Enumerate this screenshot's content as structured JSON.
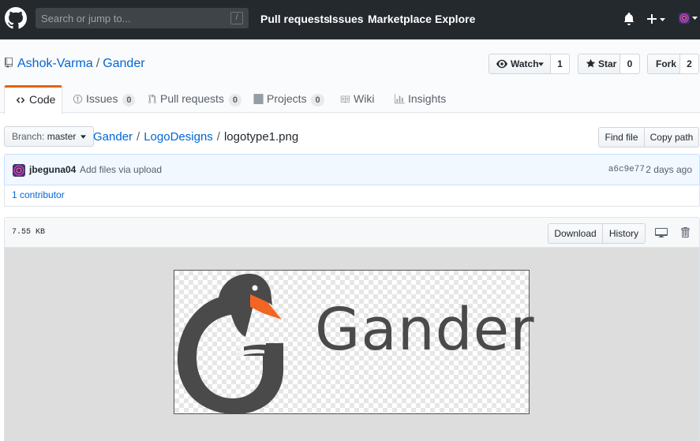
{
  "header": {
    "search_placeholder": "Search or jump to...",
    "search_hotkey": "/",
    "nav": [
      "Pull requests",
      "Issues",
      "Marketplace",
      "Explore"
    ]
  },
  "repo": {
    "owner": "Ashok-Varma",
    "name": "Gander",
    "watch_label": "Watch",
    "watch_count": "1",
    "star_label": "Star",
    "star_count": "0",
    "fork_label": "Fork",
    "fork_count": "2"
  },
  "tabs": [
    {
      "label": "Code"
    },
    {
      "label": "Issues",
      "count": "0"
    },
    {
      "label": "Pull requests",
      "count": "0"
    },
    {
      "label": "Projects",
      "count": "0"
    },
    {
      "label": "Wiki"
    },
    {
      "label": "Insights"
    }
  ],
  "file_nav": {
    "branch_prefix": "Branch:",
    "branch": "master",
    "path": [
      "Gander",
      "LogoDesigns"
    ],
    "filename": "logotype1.png",
    "find_file": "Find file",
    "copy_path": "Copy path"
  },
  "commit": {
    "author": "jbeguna04",
    "message": "Add files via upload",
    "sha": "a6c9e77",
    "time": "2 days ago",
    "contributors": "1 contributor"
  },
  "file": {
    "size": "7.55 KB",
    "download": "Download",
    "history": "History",
    "logo_text": "Gander"
  },
  "colors": {
    "header_bg": "#24292e",
    "link": "#0366d6",
    "tab_accent": "#e36209",
    "logo_gray": "#4a4a4a",
    "beak_orange": "#f26522"
  }
}
